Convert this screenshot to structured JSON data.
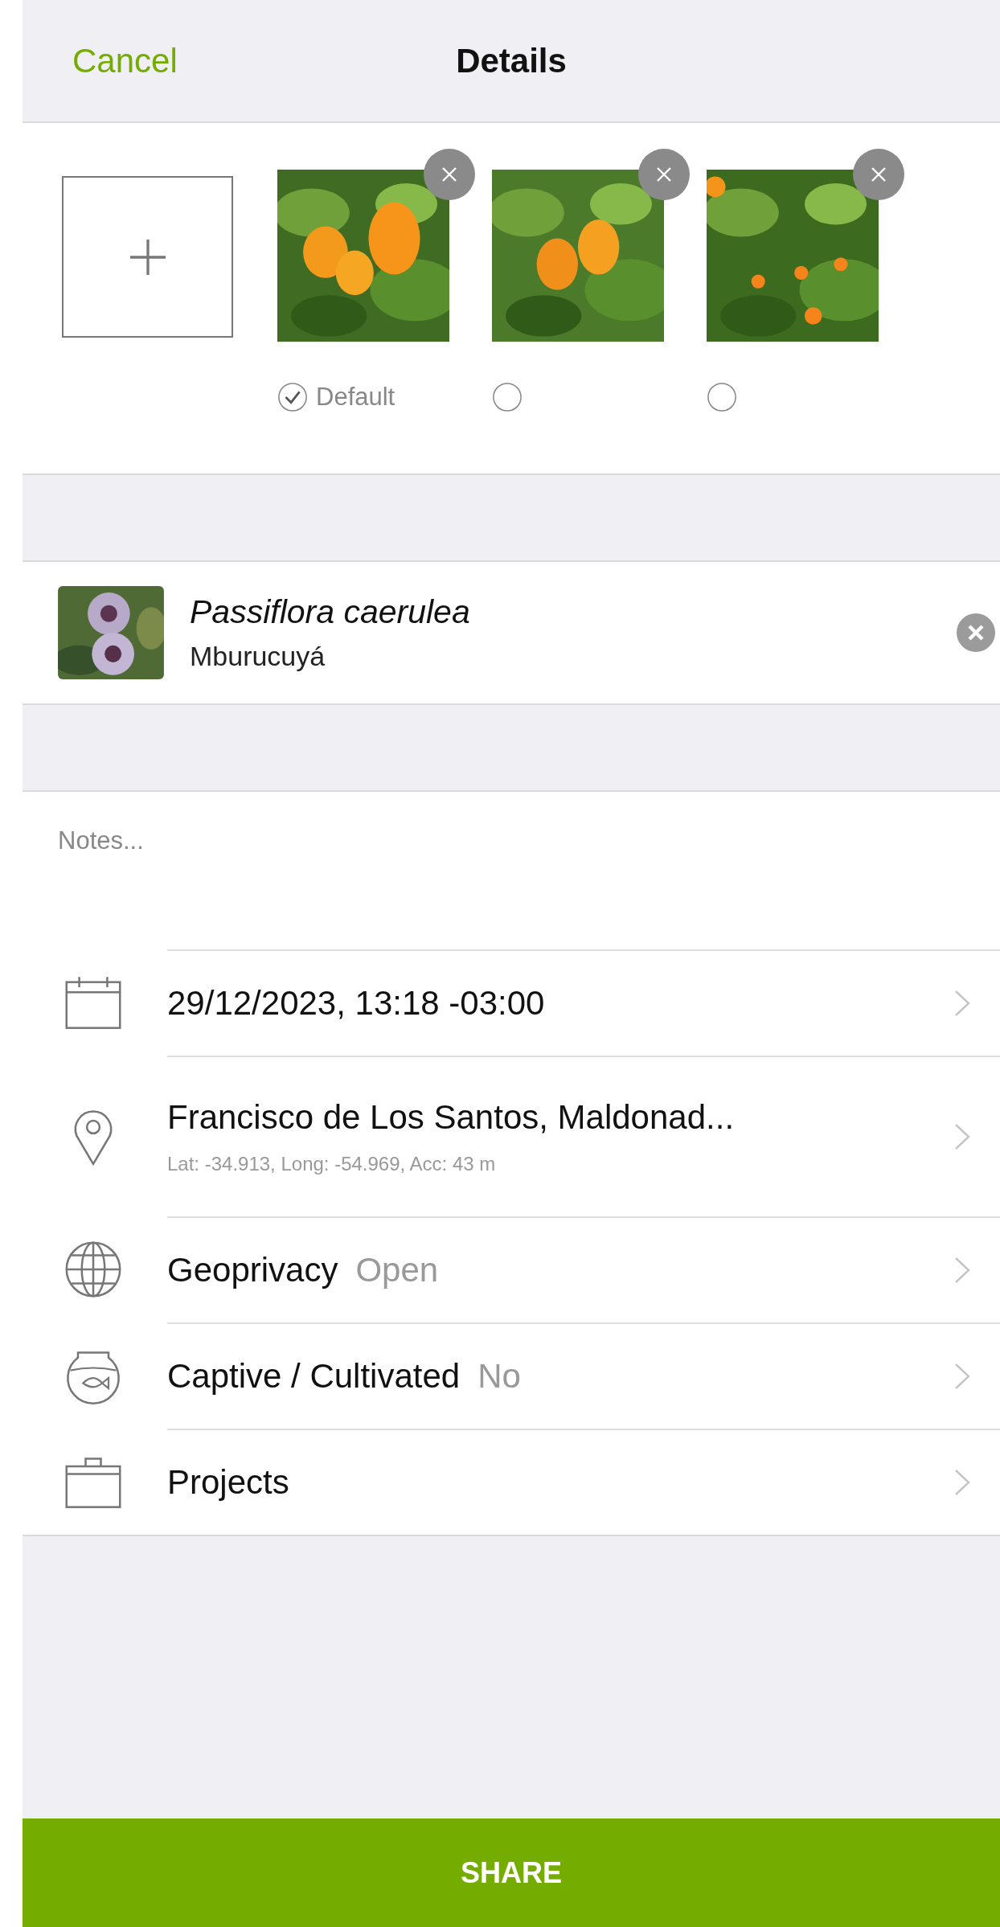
{
  "nav": {
    "cancel": "Cancel",
    "title": "Details"
  },
  "photos": [
    {
      "kind": "picture",
      "selected": true,
      "label": "Default"
    },
    {
      "kind": "picture",
      "selected": false
    },
    {
      "kind": "picture",
      "selected": false
    }
  ],
  "taxon": {
    "scientific_name": "Passiflora caerulea",
    "common_name": "Mburucuyá"
  },
  "notes": {
    "placeholder": "Notes..."
  },
  "rows": [
    {
      "kind": "date",
      "title": "29/12/2023, 13:18 -03:00"
    },
    {
      "kind": "location",
      "title": "Francisco de Los Santos, Maldonad...",
      "subtitle": "Lat: -34.913, Long: -54.969, Acc: 43 m"
    },
    {
      "kind": "geoprivacy",
      "title": "Geoprivacy",
      "value": "Open"
    },
    {
      "kind": "captive",
      "title": "Captive / Cultivated",
      "value": "No"
    },
    {
      "kind": "projects",
      "title": "Projects"
    }
  ],
  "share_button": "SHARE"
}
